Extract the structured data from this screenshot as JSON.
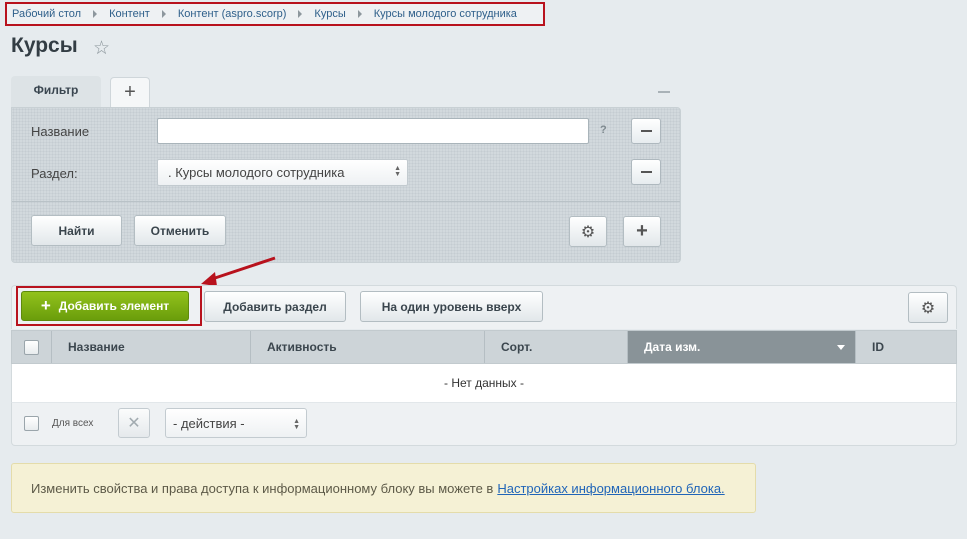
{
  "breadcrumb": [
    "Рабочий стол",
    "Контент",
    "Контент (aspro.scorp)",
    "Курсы",
    "Курсы молодого сотрудника"
  ],
  "page": {
    "title": "Курсы"
  },
  "filter": {
    "tab_label": "Фильтр",
    "fields": {
      "name_label": "Название",
      "name_value": "",
      "name_help": "?",
      "section_label": "Раздел:",
      "section_value": ". Курсы молодого сотрудника"
    },
    "find_label": "Найти",
    "cancel_label": "Отменить"
  },
  "toolbar": {
    "add_element": "Добавить элемент",
    "add_section": "Добавить раздел",
    "level_up": "На один уровень вверх"
  },
  "table": {
    "columns": [
      "Название",
      "Активность",
      "Сорт.",
      "Дата изм.",
      "ID"
    ],
    "sorted_column": "Дата изм.",
    "empty_text": "- Нет данных -"
  },
  "footer": {
    "for_all": "Для всех",
    "actions_value": "- действия -"
  },
  "info": {
    "text": "Изменить свойства и права доступа к информационному блоку вы можете в",
    "link": "Настройках информационного блока."
  },
  "colors": {
    "highlight": "#b8121d",
    "add_button": "#7aad12",
    "link": "#2065b8"
  }
}
